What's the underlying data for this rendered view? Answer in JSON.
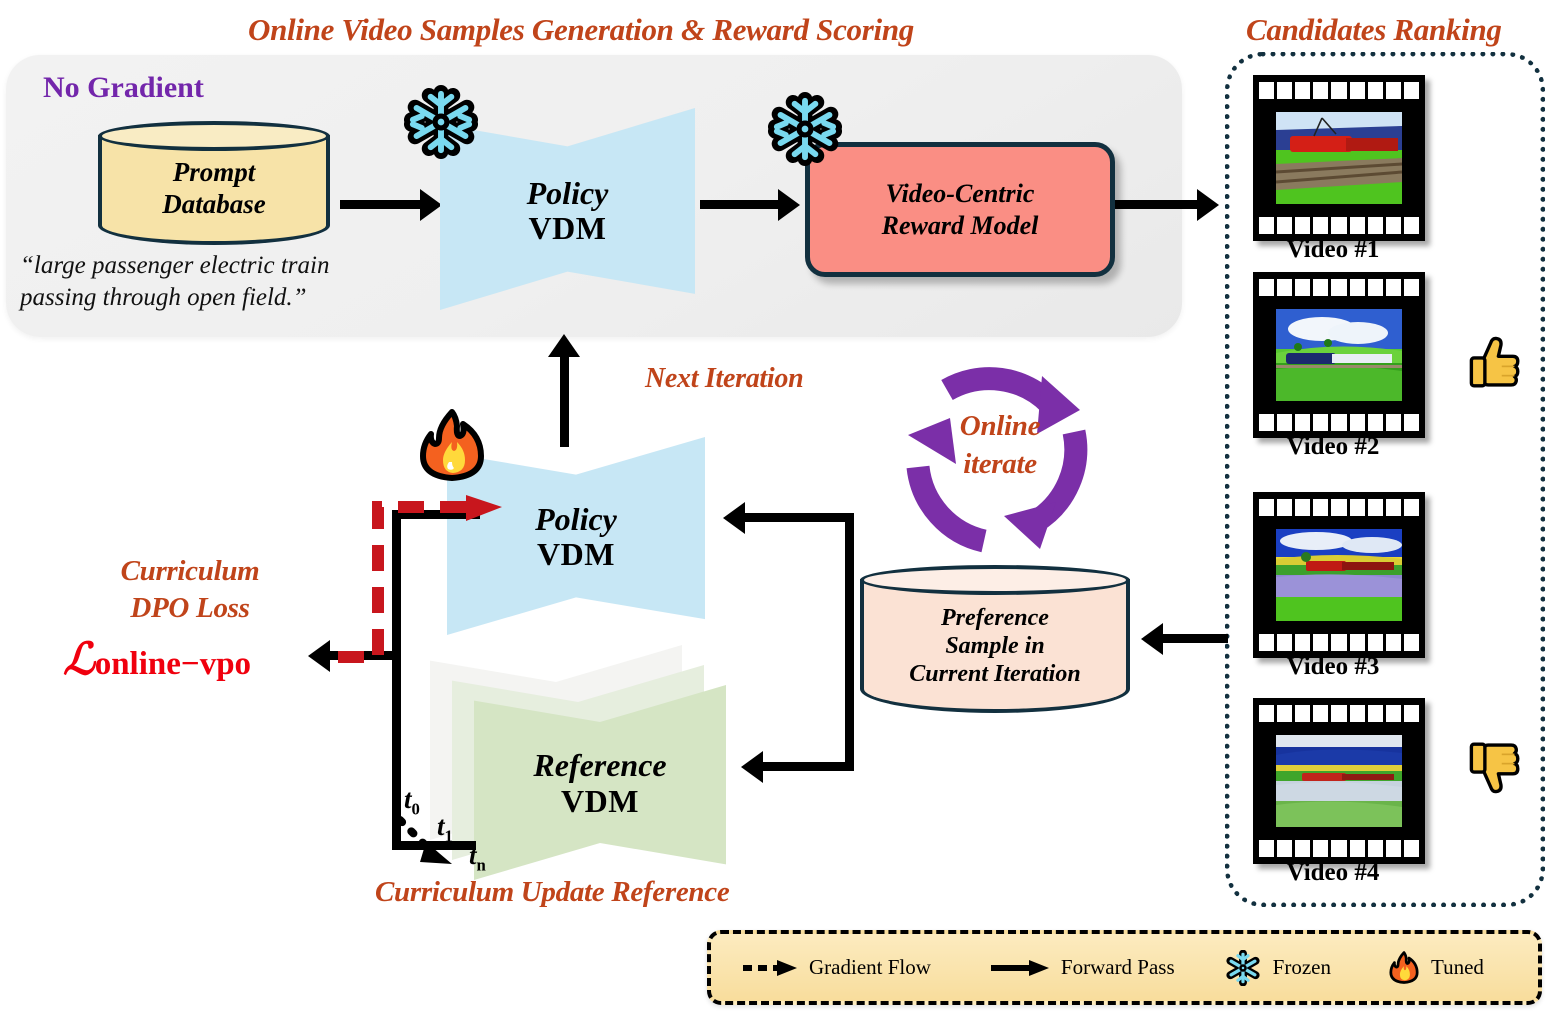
{
  "titles": {
    "generation": "Online Video Samples Generation & Reward Scoring",
    "ranking": "Candidates Ranking",
    "no_gradient": "No Gradient"
  },
  "prompt_db": {
    "line1": "Prompt",
    "line2": "Database",
    "quote_line1": "“large passenger electric train",
    "quote_line2": "passing through open field.”"
  },
  "policy_top": {
    "line1": "Policy",
    "line2": "VDM",
    "badge": "snowflake-icon"
  },
  "reward_model": {
    "line1": "Video-Centric",
    "line2": "Reward Model",
    "badge": "snowflake-icon"
  },
  "policy_bottom": {
    "line1": "Policy",
    "line2": "VDM",
    "badge": "fire-icon"
  },
  "reference": {
    "line1": "Reference",
    "line2": "VDM"
  },
  "labels": {
    "next_iteration": "Next Iteration",
    "online_iterate_l1": "Online",
    "online_iterate_l2": "iterate",
    "curriculum_dpo_l1": "Curriculum",
    "curriculum_dpo_l2": "DPO Loss",
    "curriculum_update": "Curriculum Update Reference",
    "loss_symbol": "ℒ",
    "loss_sub": "online−vpo",
    "t0": "t",
    "t0_sub": "0",
    "t1": "t",
    "t1_sub": "1",
    "tn": "t",
    "tn_sub": "n"
  },
  "preference_db": {
    "line1": "Preference",
    "line2": "Sample in",
    "line3": "Current Iteration"
  },
  "candidates": [
    {
      "label": "Video #1",
      "verdict": "",
      "sky": "#4560b8",
      "ground": "#49c423",
      "accent": "#cf1f18"
    },
    {
      "label": "Video #2",
      "verdict": "thumbs-up-icon",
      "sky": "#2f5fd0",
      "ground": "#4fcc2a",
      "accent": "#1b2a6e"
    },
    {
      "label": "Video #3",
      "verdict": "",
      "sky": "#1a3fc2",
      "ground": "#7e86d4",
      "accent": "#c01a14"
    },
    {
      "label": "Video #4",
      "verdict": "thumbs-down-icon",
      "sky": "#17339e",
      "ground": "#b9c9d8",
      "accent": "#c1241b"
    }
  ],
  "legend": [
    {
      "icon": "dashed-arrow-icon",
      "label": "Gradient Flow"
    },
    {
      "icon": "solid-arrow-icon",
      "label": "Forward Pass"
    },
    {
      "icon": "snowflake-icon",
      "label": "Frozen"
    },
    {
      "icon": "fire-icon",
      "label": "Tuned"
    }
  ],
  "colors": {
    "accent_orange": "#c0441a",
    "purple": "#7326ab",
    "iterate_purple": "#7b2fa8",
    "loss_red": "#f0000e",
    "gradient_red": "#c8161d",
    "policy_blue": "#c7e7f5",
    "reference_green": "#d5e5c4",
    "reward_pink": "#fa8e84",
    "db_yellow": "#f7e3a8",
    "pref_peach": "#fbe2d4",
    "outline_navy": "#12303f",
    "legend_yellow": "#fae4ae",
    "thumb_yellow": "#f6c445",
    "snow_cyan": "#79d9ef",
    "fire_orange": "#f4611f"
  }
}
